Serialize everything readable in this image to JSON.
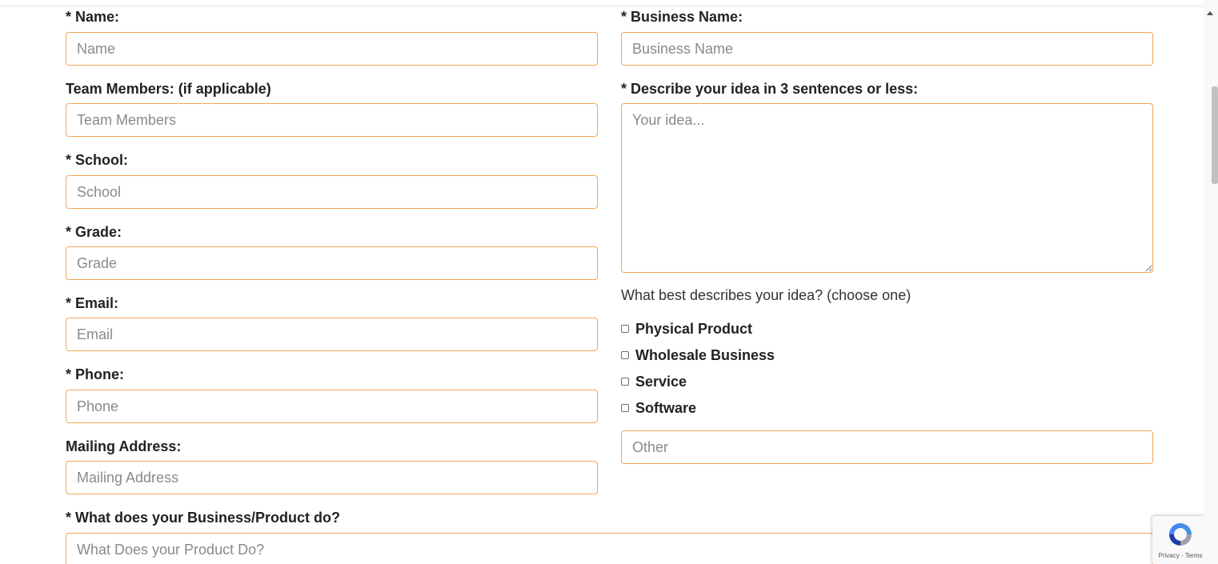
{
  "form": {
    "name": {
      "label": "* Name:",
      "placeholder": "Name"
    },
    "team_members": {
      "label": "Team Members: (if applicable)",
      "placeholder": "Team Members"
    },
    "school": {
      "label": "* School:",
      "placeholder": "School"
    },
    "grade": {
      "label": "* Grade:",
      "placeholder": "Grade"
    },
    "email": {
      "label": "* Email:",
      "placeholder": "Email"
    },
    "phone": {
      "label": "* Phone:",
      "placeholder": "Phone"
    },
    "mailing_address": {
      "label": "Mailing Address:",
      "placeholder": "Mailing Address"
    },
    "business_name": {
      "label": "* Business Name:",
      "placeholder": "Business Name"
    },
    "idea": {
      "label": "* Describe your idea in 3 sentences or less:",
      "placeholder": "Your idea..."
    },
    "idea_type": {
      "prompt": "What best describes your idea? (choose one)",
      "options": [
        "Physical Product",
        "Wholesale Business",
        "Service",
        "Software"
      ],
      "other_placeholder": "Other"
    },
    "product_does": {
      "label": "* What does your Business/Product do?",
      "placeholder": "What Does your Product Do?"
    }
  },
  "recaptcha": {
    "footer": "Privacy - Terms"
  },
  "colors": {
    "field_border": "#f0a557",
    "label_text": "#222222",
    "placeholder_text": "#8a8a8a"
  },
  "icons": {
    "recaptcha": "recaptcha-icon",
    "checkbox": "checkbox-icon",
    "scroll_up": "scroll-up-arrow-icon"
  }
}
